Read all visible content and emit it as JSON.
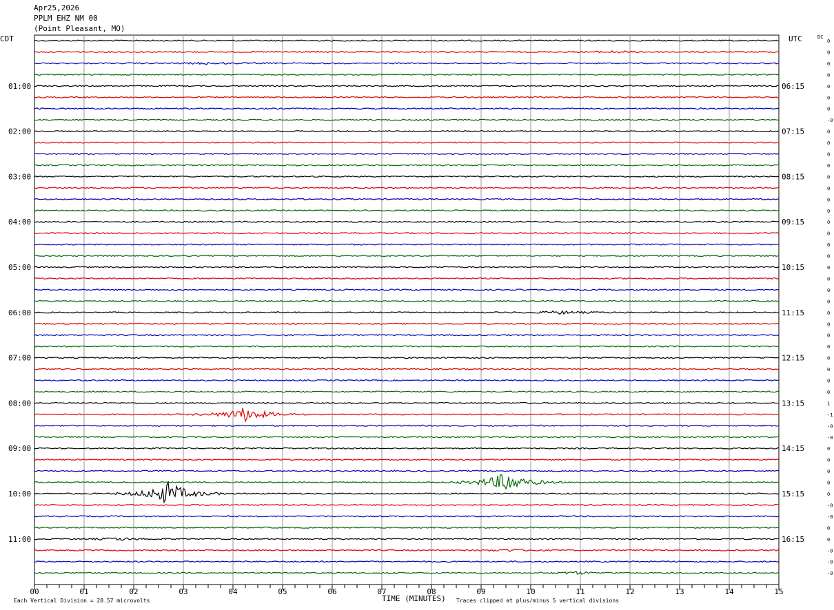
{
  "header": {
    "date": "Apr25,2026",
    "station": "PPLM EHZ NM 00",
    "location": "(Point Pleasant, MO)"
  },
  "labels": {
    "left_tz": "CDT",
    "right_tz": "UTC",
    "dc": "DC"
  },
  "footer": {
    "division": "Each Vertical Division =   28.57 microvolts",
    "clip_note": "Traces clipped at plus/minus 5 vertical divisions"
  },
  "chart_data": {
    "type": "line",
    "xlabel": "TIME (MINUTES)",
    "xlim": [
      0,
      15
    ],
    "x_ticks": [
      "00",
      "01",
      "02",
      "03",
      "04",
      "05",
      "06",
      "07",
      "08",
      "09",
      "10",
      "11",
      "12",
      "13",
      "14",
      "15"
    ],
    "trace_colors": [
      "#000000",
      "#dd0000",
      "#0000aa",
      "#006600"
    ],
    "rows_per_hour": 4,
    "left_hour_labels": [
      "01:00",
      "02:00",
      "03:00",
      "04:00",
      "05:00",
      "06:00",
      "07:00",
      "08:00",
      "09:00",
      "10:00",
      "11:00"
    ],
    "right_hour_labels": [
      "06:15",
      "07:15",
      "08:15",
      "09:15",
      "10:15",
      "11:15",
      "12:15",
      "13:15",
      "14:15",
      "15:15",
      "16:15"
    ],
    "dc_offsets": [
      "0",
      "0",
      "0",
      "0",
      "0",
      "0",
      "0",
      "-0",
      "0",
      "0",
      "0",
      "0",
      "0",
      "0",
      "0",
      "0",
      "0",
      "0",
      "0",
      "0",
      "0",
      "0",
      "0",
      "0",
      "0",
      "0",
      "0",
      "0",
      "0",
      "0",
      "0",
      "0",
      "1",
      "-1",
      "-0",
      "-0",
      "0",
      "0",
      "0",
      "0",
      "0",
      "-0",
      "-0",
      "0",
      "0",
      "-0",
      "-0",
      "-0"
    ],
    "events": [
      {
        "row": 2,
        "minute": 3.5,
        "amplitude": 0.3
      },
      {
        "row": 1,
        "minute": 11.7,
        "amplitude": 0.3
      },
      {
        "row": 24,
        "minute": 10.6,
        "amplitude": 0.5
      },
      {
        "row": 33,
        "minute": 4.25,
        "amplitude": 2.5
      },
      {
        "row": 39,
        "minute": 9.5,
        "amplitude": 3.5
      },
      {
        "row": 40,
        "minute": 2.7,
        "amplitude": 4.0
      },
      {
        "row": 44,
        "minute": 1.7,
        "amplitude": 0.4
      },
      {
        "row": 45,
        "minute": 9.6,
        "amplitude": 0.4
      },
      {
        "row": 47,
        "minute": 10.9,
        "amplitude": 0.4
      }
    ]
  }
}
